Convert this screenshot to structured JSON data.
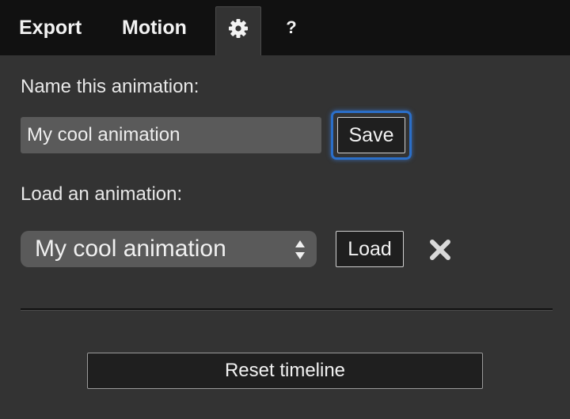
{
  "tabs": {
    "export_label": "Export",
    "motion_label": "Motion",
    "settings_icon": "gear-icon",
    "help_label": "?"
  },
  "save_section": {
    "label": "Name this animation:",
    "name_value": "My cool animation",
    "save_label": "Save"
  },
  "load_section": {
    "label": "Load an animation:",
    "selected_animation": "My cool animation",
    "load_label": "Load",
    "delete_icon": "close-icon"
  },
  "reset_label": "Reset timeline",
  "colors": {
    "background": "#333333",
    "tabbar": "#111111",
    "focus_ring": "#2b6fc9",
    "input_bg": "#5a5a5a"
  }
}
